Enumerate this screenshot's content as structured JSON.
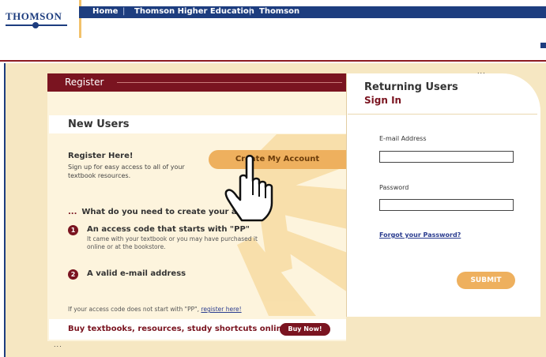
{
  "brand": {
    "logo_text": "THOMSON"
  },
  "nav": {
    "items": [
      "Home",
      "Thomson Higher Education",
      "Thomson"
    ],
    "separator": "|"
  },
  "register_section": {
    "header_title": "Register",
    "new_users_title": "New Users",
    "register_here_title": "Register Here!",
    "signup_text": "Sign up for easy access to all of your textbook resources.",
    "create_button_label": "Create My Account",
    "what_need_prefix": "...",
    "what_need_text": "What do you need to create your account?",
    "steps": [
      {
        "number": "1",
        "title": "An access code that starts with \"PP\"",
        "description": "It came with your textbook or you may have purchased it online or at the bookstore."
      },
      {
        "number": "2",
        "title": "A valid e-mail address",
        "description": ""
      }
    ],
    "access_note_text": "If your access code does not start with \"PP\", ",
    "access_note_link": "register here!"
  },
  "buy_bar": {
    "text": "Buy textbooks, resources, study shortcuts online!",
    "button_label": "Buy Now!"
  },
  "returning_users": {
    "title": "Returning Users",
    "subtitle": "Sign In",
    "email_label": "E-mail Address",
    "email_value": "",
    "password_label": "Password",
    "password_value": "",
    "forgot_link": "Forgot your Password?",
    "submit_label": "SUBMIT"
  },
  "decor": {
    "dots": "..."
  },
  "colors": {
    "brand_blue": "#1d3d7f",
    "maroon": "#7a1420",
    "orange": "#eeb05e",
    "peach": "#f6e7c2",
    "link_blue": "#2a3c8f"
  },
  "icons": {
    "cursor": "hand-pointer-icon",
    "step_badge": "numbered-circle-icon"
  }
}
